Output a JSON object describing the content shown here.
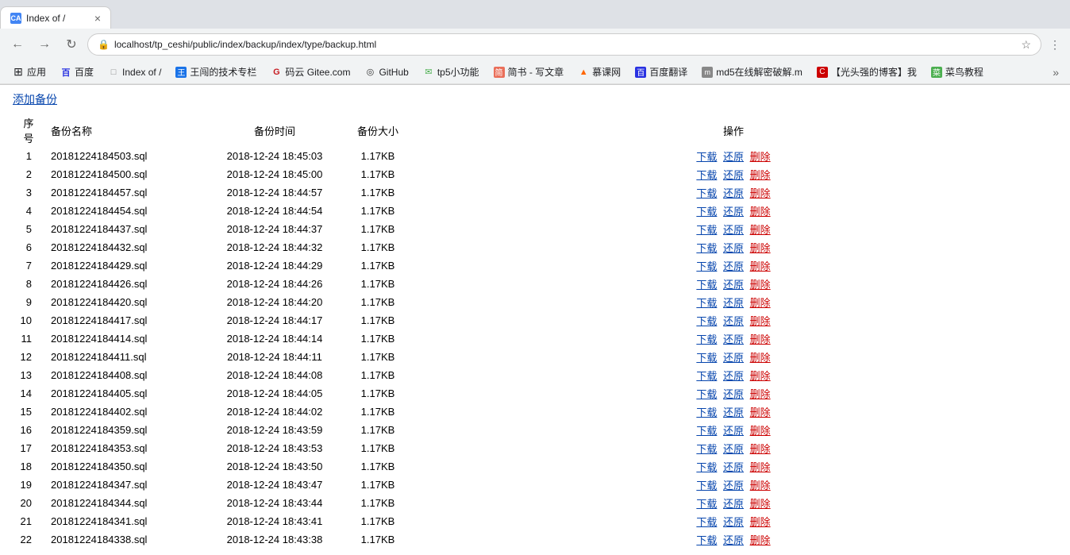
{
  "browser": {
    "tab": {
      "favicon_text": "CA",
      "title": "Index of /",
      "close_label": "×"
    },
    "nav": {
      "back_label": "←",
      "forward_label": "→",
      "close_label": "×",
      "url": "localhost/tp_ceshi/public/index/backup/index/type/backup.html",
      "star_label": "☆"
    },
    "bookmarks": [
      {
        "id": "apps",
        "icon": "⊞",
        "label": "应用",
        "type": "apps"
      },
      {
        "id": "baidu",
        "icon": "百",
        "label": "百度",
        "color": "baidu"
      },
      {
        "id": "index",
        "icon": "□",
        "label": "Index of /"
      },
      {
        "id": "wangjian",
        "icon": "王",
        "label": "王闯的技术专栏"
      },
      {
        "id": "gitee",
        "icon": "G",
        "label": "码云 Gitee.com"
      },
      {
        "id": "github",
        "icon": "◎",
        "label": "GitHub"
      },
      {
        "id": "tp5",
        "icon": "✉",
        "label": "tp5小功能"
      },
      {
        "id": "jian",
        "icon": "简",
        "label": "简书 - 写文章"
      },
      {
        "id": "muke",
        "icon": "▲",
        "label": "慕课网"
      },
      {
        "id": "baidufan",
        "icon": "百",
        "label": "百度翻译"
      },
      {
        "id": "md5",
        "icon": "m",
        "label": "md5在线解密破解.m"
      },
      {
        "id": "guangtou",
        "icon": "C",
        "label": "【光头强的博客】我"
      },
      {
        "id": "runoob",
        "icon": "菜",
        "label": "菜鸟教程"
      },
      {
        "id": "more",
        "icon": "»",
        "label": ""
      }
    ]
  },
  "page": {
    "add_backup_label": "添加备份",
    "table": {
      "headers": [
        "序号",
        "备份名称",
        "备份时间",
        "备份大小",
        "操作"
      ],
      "action_labels": {
        "download": "下载",
        "restore": "还原",
        "delete": "删除"
      },
      "rows": [
        {
          "no": 1,
          "name": "20181224184503.sql",
          "time": "2018-12-24 18:45:03",
          "size": "1.17KB"
        },
        {
          "no": 2,
          "name": "20181224184500.sql",
          "time": "2018-12-24 18:45:00",
          "size": "1.17KB"
        },
        {
          "no": 3,
          "name": "20181224184457.sql",
          "time": "2018-12-24 18:44:57",
          "size": "1.17KB"
        },
        {
          "no": 4,
          "name": "20181224184454.sql",
          "time": "2018-12-24 18:44:54",
          "size": "1.17KB"
        },
        {
          "no": 5,
          "name": "20181224184437.sql",
          "time": "2018-12-24 18:44:37",
          "size": "1.17KB"
        },
        {
          "no": 6,
          "name": "20181224184432.sql",
          "time": "2018-12-24 18:44:32",
          "size": "1.17KB"
        },
        {
          "no": 7,
          "name": "20181224184429.sql",
          "time": "2018-12-24 18:44:29",
          "size": "1.17KB"
        },
        {
          "no": 8,
          "name": "20181224184426.sql",
          "time": "2018-12-24 18:44:26",
          "size": "1.17KB"
        },
        {
          "no": 9,
          "name": "20181224184420.sql",
          "time": "2018-12-24 18:44:20",
          "size": "1.17KB"
        },
        {
          "no": 10,
          "name": "20181224184417.sql",
          "time": "2018-12-24 18:44:17",
          "size": "1.17KB"
        },
        {
          "no": 11,
          "name": "20181224184414.sql",
          "time": "2018-12-24 18:44:14",
          "size": "1.17KB"
        },
        {
          "no": 12,
          "name": "20181224184411.sql",
          "time": "2018-12-24 18:44:11",
          "size": "1.17KB"
        },
        {
          "no": 13,
          "name": "20181224184408.sql",
          "time": "2018-12-24 18:44:08",
          "size": "1.17KB"
        },
        {
          "no": 14,
          "name": "20181224184405.sql",
          "time": "2018-12-24 18:44:05",
          "size": "1.17KB"
        },
        {
          "no": 15,
          "name": "20181224184402.sql",
          "time": "2018-12-24 18:44:02",
          "size": "1.17KB"
        },
        {
          "no": 16,
          "name": "20181224184359.sql",
          "time": "2018-12-24 18:43:59",
          "size": "1.17KB"
        },
        {
          "no": 17,
          "name": "20181224184353.sql",
          "time": "2018-12-24 18:43:53",
          "size": "1.17KB"
        },
        {
          "no": 18,
          "name": "20181224184350.sql",
          "time": "2018-12-24 18:43:50",
          "size": "1.17KB"
        },
        {
          "no": 19,
          "name": "20181224184347.sql",
          "time": "2018-12-24 18:43:47",
          "size": "1.17KB"
        },
        {
          "no": 20,
          "name": "20181224184344.sql",
          "time": "2018-12-24 18:43:44",
          "size": "1.17KB"
        },
        {
          "no": 21,
          "name": "20181224184341.sql",
          "time": "2018-12-24 18:43:41",
          "size": "1.17KB"
        },
        {
          "no": 22,
          "name": "20181224184338.sql",
          "time": "2018-12-24 18:43:38",
          "size": "1.17KB"
        }
      ]
    }
  }
}
